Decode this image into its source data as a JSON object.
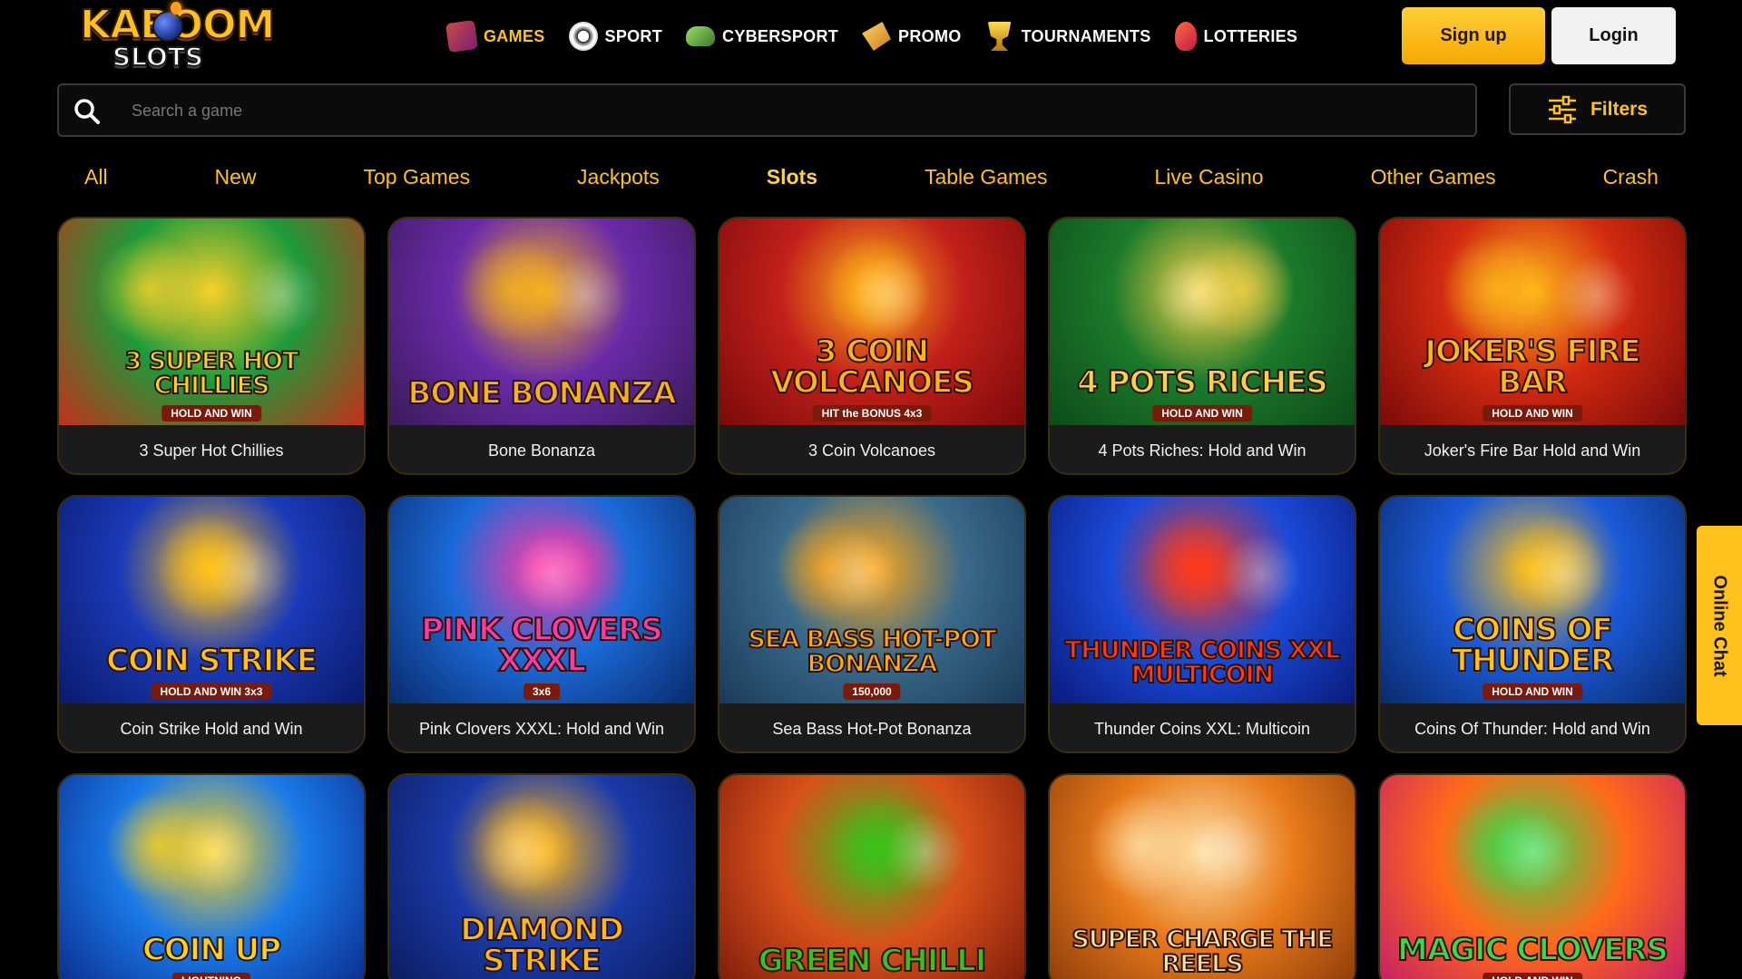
{
  "header": {
    "logo": {
      "top": "KABOOM",
      "bottom": "SLOTS"
    },
    "nav": [
      {
        "label": "GAMES",
        "icon": "slot-machine-icon",
        "active": true
      },
      {
        "label": "SPORT",
        "icon": "soccer-ball-icon",
        "active": false
      },
      {
        "label": "CYBERSPORT",
        "icon": "gamepad-icon",
        "active": false
      },
      {
        "label": "PROMO",
        "icon": "megaphone-icon",
        "active": false
      },
      {
        "label": "TOURNAMENTS",
        "icon": "trophy-icon",
        "active": false
      },
      {
        "label": "LOTTERIES",
        "icon": "lottery-ball-icon",
        "active": false
      }
    ],
    "signup_label": "Sign up",
    "login_label": "Login"
  },
  "search": {
    "placeholder": "Search a game",
    "value": ""
  },
  "filters_label": "Filters",
  "tabs": [
    {
      "label": "All",
      "active": false
    },
    {
      "label": "New",
      "active": false
    },
    {
      "label": "Top Games",
      "active": false
    },
    {
      "label": "Jackpots",
      "active": false
    },
    {
      "label": "Slots",
      "active": true
    },
    {
      "label": "Table Games",
      "active": false
    },
    {
      "label": "Live Casino",
      "active": false
    },
    {
      "label": "Other Games",
      "active": false
    },
    {
      "label": "Crash",
      "active": false
    }
  ],
  "games": [
    {
      "name": "3 Super Hot Chillies",
      "art_title": "3 SUPER HOT CHILLIES",
      "art_sub": "HOLD AND WIN",
      "colors": [
        "#1d9a3a",
        "#f7d12a",
        "#c3301a"
      ]
    },
    {
      "name": "Bone Bonanza",
      "art_title": "BONE BONANZA",
      "art_sub": "",
      "colors": [
        "#6a2aa8",
        "#f6b21c",
        "#3a1a5a"
      ]
    },
    {
      "name": "3 Coin Volcanoes",
      "art_title": "3 COIN VOLCANOES",
      "art_sub": "HIT the BONUS 4x3",
      "colors": [
        "#c2201a",
        "#ffb21a",
        "#7a0a0a"
      ]
    },
    {
      "name": "4 Pots Riches: Hold and Win",
      "art_title": "4 POTS RICHES",
      "art_sub": "HOLD AND WIN",
      "colors": [
        "#1b7a2a",
        "#f8d24a",
        "#0e4a1a"
      ]
    },
    {
      "name": "Joker's Fire Bar Hold and Win",
      "art_title": "JOKER'S FIRE BAR",
      "art_sub": "HOLD AND WIN",
      "colors": [
        "#d12a10",
        "#ffb81c",
        "#7a0a0a"
      ]
    },
    {
      "name": "Coin Strike Hold and Win",
      "art_title": "COIN STRIKE",
      "art_sub": "HOLD AND WIN 3x3",
      "colors": [
        "#1a3ab8",
        "#ffc21a",
        "#0a1a6a"
      ]
    },
    {
      "name": "Pink Clovers XXXL: Hold and Win",
      "art_title": "PINK CLOVERS XXXL",
      "art_sub": "3x6",
      "colors": [
        "#1a6ad8",
        "#ff3aa8",
        "#0a2a6a"
      ]
    },
    {
      "name": "Sea Bass Hot-Pot Bonanza",
      "art_title": "SEA BASS HOT-POT BONANZA",
      "art_sub": "150,000",
      "colors": [
        "#3a6a8a",
        "#ffa81a",
        "#1a3a5a"
      ]
    },
    {
      "name": "Thunder Coins XXL: Multicoin",
      "art_title": "THUNDER COINS XXL MULTICOIN",
      "art_sub": "",
      "colors": [
        "#1a4ad8",
        "#ff3a1a",
        "#0a1a7a"
      ]
    },
    {
      "name": "Coins Of Thunder: Hold and Win",
      "art_title": "COINS OF THUNDER",
      "art_sub": "HOLD AND WIN",
      "colors": [
        "#1a5ad8",
        "#ffc21a",
        "#0a2a6a"
      ]
    },
    {
      "name": "",
      "art_title": "COIN UP",
      "art_sub": "LIGHTNING",
      "colors": [
        "#1a7ae8",
        "#ffd21a",
        "#0a2a8a"
      ]
    },
    {
      "name": "",
      "art_title": "DIAMOND STRIKE",
      "art_sub": "",
      "colors": [
        "#1a3aa8",
        "#ffb81c",
        "#0a1a5a"
      ]
    },
    {
      "name": "",
      "art_title": "GREEN CHILLI",
      "art_sub": "",
      "colors": [
        "#d8501a",
        "#3ac21a",
        "#7a1a0a"
      ]
    },
    {
      "name": "",
      "art_title": "SUPER CHARGE THE REELS",
      "art_sub": "",
      "colors": [
        "#e87a1a",
        "#ffe2a8",
        "#8a3a0a"
      ]
    },
    {
      "name": "",
      "art_title": "MAGIC CLOVERS",
      "art_sub": "HOLD AND WIN",
      "colors": [
        "#ff6a1a",
        "#3ad84a",
        "#c21a6a"
      ]
    }
  ],
  "chat_label": "Online Chat"
}
